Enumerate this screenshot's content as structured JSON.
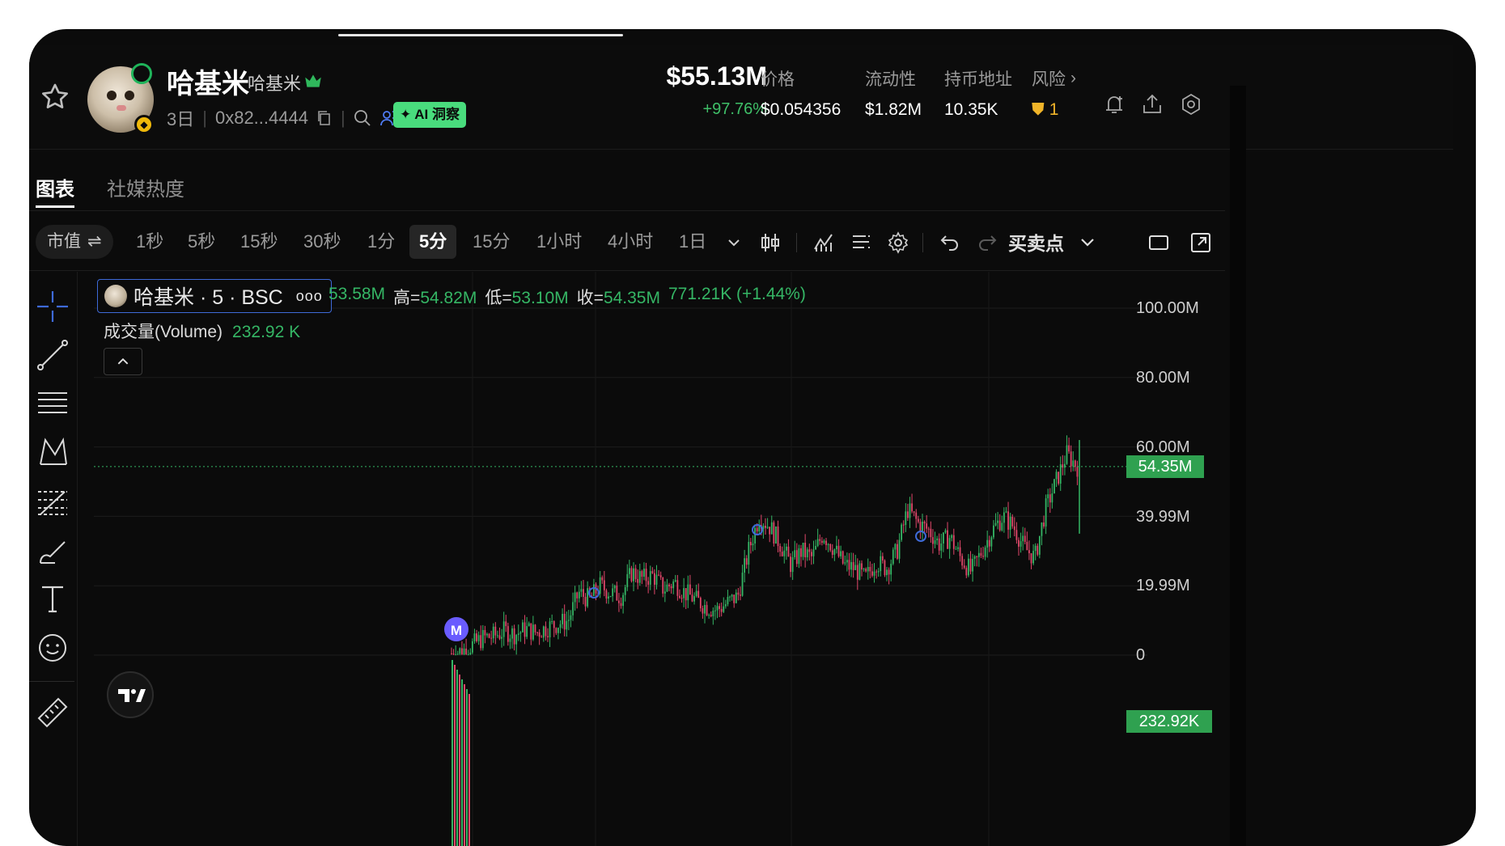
{
  "header": {
    "token_name": "哈基米",
    "token_sub": "哈基米",
    "age": "3日",
    "address": "0x82...4444",
    "ai_badge": "AI 洞察",
    "market_cap": "$55.13M",
    "market_cap_change": "+97.76%",
    "stats": {
      "price_label": "价格",
      "price_value": "$0.054356",
      "liquidity_label": "流动性",
      "liquidity_value": "$1.82M",
      "holders_label": "持币地址",
      "holders_value": "10.35K",
      "risk_label": "风险",
      "risk_value": "1"
    }
  },
  "tabs": [
    "图表",
    "社媒热度"
  ],
  "toolbar": {
    "mcap_toggle": "市值",
    "timeframes": [
      "1秒",
      "5秒",
      "15秒",
      "30秒",
      "1分",
      "5分",
      "15分",
      "1小时",
      "4小时",
      "1日"
    ],
    "active_timeframe": "5分",
    "trade_points": "买卖点"
  },
  "legend": {
    "symbol": "哈基米 · 5 · BSC",
    "more": "ooo",
    "open_partial": "53.58M",
    "high_label": "高=",
    "high_value": "54.82M",
    "low_label": "低=",
    "low_value": "53.10M",
    "close_label": "收=",
    "close_value": "54.35M",
    "change": "771.21K (+1.44%)",
    "volume_label": "成交量(Volume)",
    "volume_value": "232.92 K"
  },
  "chart_data": {
    "type": "candlestick",
    "y_axis_ticks": [
      "100.00M",
      "80.00M",
      "60.00M",
      "39.99M",
      "19.99M",
      "0"
    ],
    "ylim": [
      0,
      100
    ],
    "unit": "M",
    "current_value_label": "54.35M",
    "volume_label": "232.92K",
    "marker": "M",
    "close_series_approx": [
      0.5,
      1.2,
      3,
      5,
      5.5,
      7,
      6,
      7.5,
      6.5,
      8,
      9,
      10,
      18,
      16,
      20,
      18,
      17,
      24,
      22,
      23,
      19,
      21,
      18,
      16,
      14,
      13,
      15,
      17,
      30,
      40,
      37,
      32,
      26,
      30,
      28,
      35,
      31,
      26,
      25,
      22,
      27,
      25,
      30,
      42,
      38,
      36,
      32,
      34,
      28,
      24,
      30,
      36,
      40,
      37,
      31,
      28,
      42,
      50,
      58,
      54.35
    ]
  },
  "colors": {
    "up": "#35b665",
    "down": "#e0476a",
    "accent_blue": "#3e6ad8",
    "marker_purple": "#6a5cff"
  }
}
